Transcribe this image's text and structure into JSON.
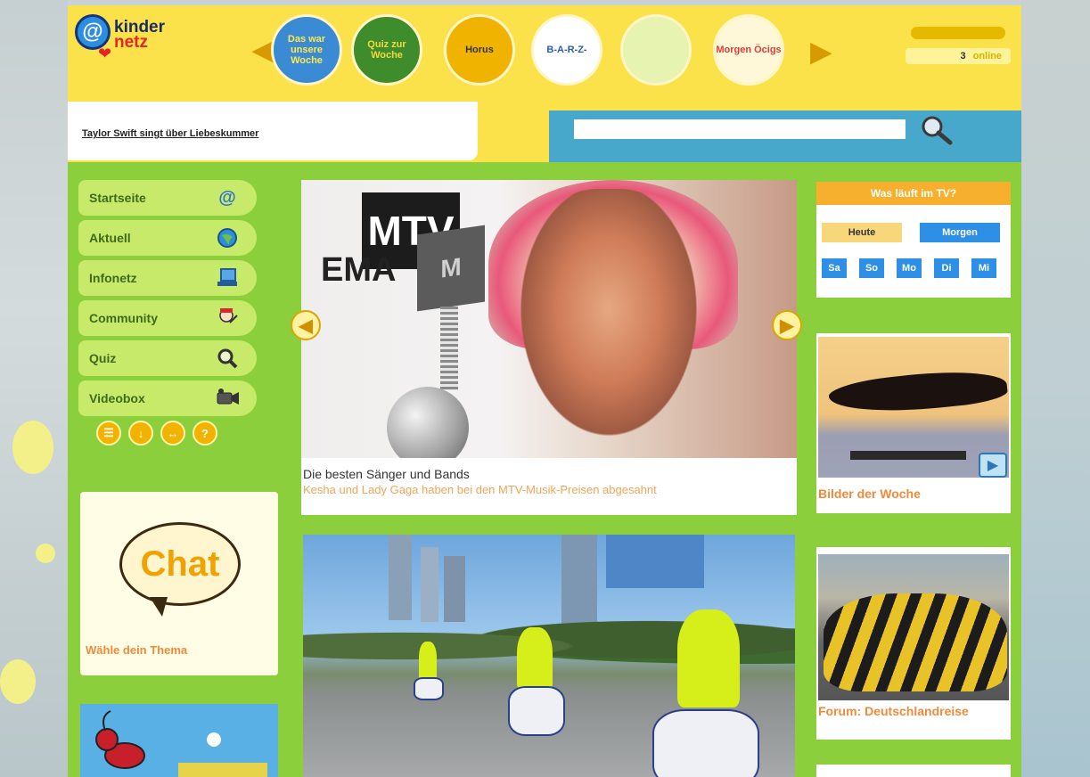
{
  "header": {
    "logo": {
      "line1": "kinder",
      "line2": "netz",
      "mark": "@"
    },
    "shows": [
      {
        "name": "Das war unsere Woche",
        "bg": "#3a8bd4",
        "fg": "#ffe84a"
      },
      {
        "name": "Quiz zur Woche",
        "bg": "#3e8c2c",
        "fg": "#f5d93a"
      },
      {
        "name": "Horus",
        "bg": "#f0b400",
        "fg": "#333333"
      },
      {
        "name": "B-A-R-Z-",
        "bg": "#ffffff",
        "fg": "#2a5db0"
      },
      {
        "name": "",
        "bg": "#e7f3b0",
        "fg": "#b3263a"
      },
      {
        "name": "Morgen Öcigs",
        "bg": "#fff8d8",
        "fg": "#e03a3a"
      }
    ],
    "online": {
      "label": "online",
      "count": "3"
    }
  },
  "headline": {
    "text": "Taylor Swift singt über Liebeskummer"
  },
  "search": {
    "placeholder": ""
  },
  "nav": {
    "items": [
      {
        "label": "Startseite",
        "icon": "kindernetz-logo-icon"
      },
      {
        "label": "Aktuell",
        "icon": "globe-icon"
      },
      {
        "label": "Infonetz",
        "icon": "laptop-icon"
      },
      {
        "label": "Community",
        "icon": "people-icon"
      },
      {
        "label": "Quiz",
        "icon": "magnifier-icon"
      },
      {
        "label": "Videobox",
        "icon": "camera-icon"
      }
    ],
    "small_icons": [
      "☰",
      "↓",
      "↔",
      "?"
    ]
  },
  "chat": {
    "bubble": "Chat",
    "label": "Wähle dein Thema"
  },
  "feature": {
    "title": "Die besten Sänger und Bands",
    "subtitle": "Kesha und Lady Gaga haben bei den MTV-Musik-Preisen abgesahnt",
    "logo_text": "MTV",
    "logo_sub": "EMA",
    "prev": "◀",
    "next": "▶"
  },
  "tv": {
    "title": "Was läuft im TV?",
    "today": "Heute",
    "tomorrow": "Morgen",
    "weekdays": [
      "Sa",
      "So",
      "Mo",
      "Di",
      "Mi"
    ]
  },
  "pictures": {
    "label": "Bilder der Woche"
  },
  "forum": {
    "label": "Forum: Deutschlandreise"
  }
}
